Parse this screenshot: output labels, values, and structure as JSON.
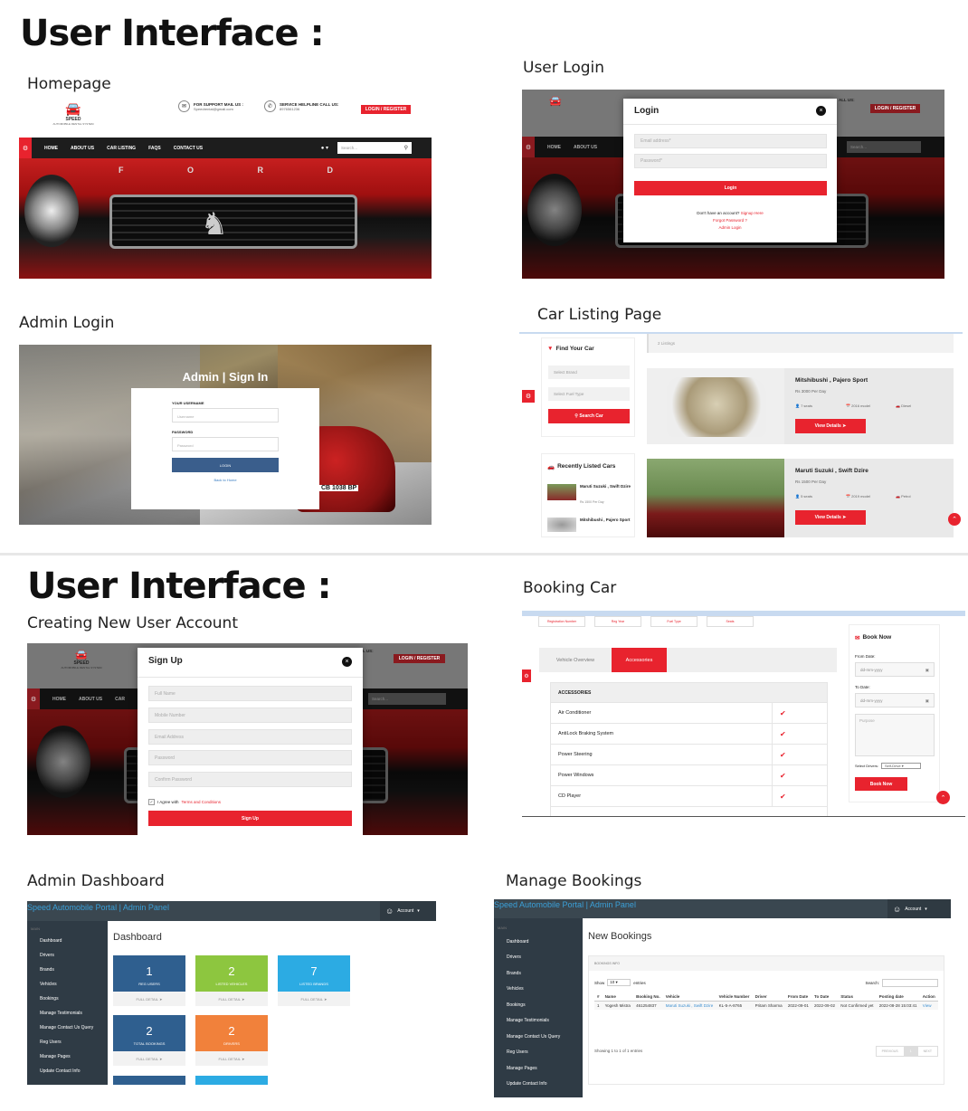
{
  "sections": {
    "top_heading": "User Interface :",
    "bottom_heading": "User Interface :"
  },
  "captions": {
    "homepage": "Homepage",
    "user_login": "User Login",
    "admin_login": "Admin Login",
    "car_listing": "Car Listing Page",
    "creating_account": "Creating New User Account",
    "booking_car": "Booking Car",
    "admin_dashboard": "Admin Dashboard",
    "manage_bookings": "Manage Bookings"
  },
  "homepage": {
    "brand": "SPEED",
    "brand_sub": "AUTOMOBILE RENTAL SYSTEM",
    "support_label": "FOR SUPPORT MAIL US :",
    "support_value": "Speedrental@gmail.com",
    "helpline_label": "SERVICE HELPLINE CALL US:",
    "helpline_value": "8976561236",
    "login_button": "LOGIN / REGISTER",
    "nav": [
      "HOME",
      "ABOUT US",
      "CAR LISTING",
      "FAQS",
      "CONTACT US"
    ],
    "search_placeholder": "Search...",
    "car_letters": "F O R D"
  },
  "user_login": {
    "title": "Login",
    "email_placeholder": "Email address*",
    "password_placeholder": "Password*",
    "login_button": "Login",
    "signup_prompt": "Don't have an account?",
    "signup_link": "Signup Here",
    "forgot_link": "Forgot Password ?",
    "admin_link": "Admin Login",
    "call_us_fragment": "ALL US:",
    "login_register": "LOGIN / REGISTER",
    "nav": [
      "HOME",
      "ABOUT US"
    ],
    "search_placeholder": "Search..."
  },
  "admin_login": {
    "title": "Admin | Sign In",
    "username_label": "YOUR USERNAME",
    "username_placeholder": "Username",
    "password_label": "PASSWORD",
    "password_placeholder": "Password",
    "login_button": "LOGIN",
    "back_link": "Back to Home",
    "plate": "CB 1038 BP"
  },
  "car_listing": {
    "find_title": "Find Your Car",
    "brand_select": "Select Brand",
    "fuel_select": "Select Fuel Type",
    "search_button": "Search Car",
    "listings_count": "2 Listings",
    "recent_title": "Recently Listed Cars",
    "recent": [
      {
        "name": "Maruti Suzuki , Swift Dzire",
        "price": "Rs 1500 Per Day"
      },
      {
        "name": "Mitshibushi , Pajero Sport",
        "price": ""
      }
    ],
    "cars": [
      {
        "name": "Mitshibushi , Pajero Sport",
        "price": "Rs 3000 Per Day",
        "seats": "7 seats",
        "model": "2016 model",
        "fuel": "Diesel",
        "button": "View Details"
      },
      {
        "name": "Maruti Suzuki , Swift Dzire",
        "price": "Rs 1500 Per Day",
        "seats": "5 seats",
        "model": "2019 model",
        "fuel": "Petrol",
        "button": "View Details"
      }
    ]
  },
  "signup": {
    "title": "Sign Up",
    "fields": [
      "Full Name",
      "Mobile Number",
      "Email Address",
      "Password",
      "Confirm Password"
    ],
    "agree_text": "I Agree with",
    "terms_link": "Terms and Conditions",
    "signup_button": "Sign Up",
    "brand": "SPEED",
    "brand_sub": "AUTOMOBILE RENTAL SYSTEM",
    "login_register": "LOGIN / REGISTER",
    "call_us_fragment": "L US:",
    "nav": [
      "HOME",
      "ABOUT US",
      "CAR"
    ],
    "search_placeholder": "Search..."
  },
  "booking": {
    "spec_tabs": [
      "Registration Number",
      "Reg Year",
      "Fuel Type",
      "Seats"
    ],
    "tab_overview": "Vehicle Overview",
    "tab_accessories": "Accessories",
    "accessories_title": "ACCESSORIES",
    "accessories": [
      "Air Conditioner",
      "AntiLock Braking System",
      "Power Steering",
      "Power Windows",
      "CD Player"
    ],
    "book_title": "Book Now",
    "from_label": "From Date:",
    "to_label": "To Date:",
    "date_placeholder": "dd-mm-yyyy",
    "purpose_placeholder": "Purpose",
    "driver_label": "Select Drivers:",
    "driver_value": "Self-Drive",
    "book_button": "Book Now"
  },
  "admin_dashboard": {
    "portal_title": "Speed Automobile Portal | Admin Panel",
    "account": "Account",
    "main_label": "MAIN",
    "menu": [
      "Dashboard",
      "Drivers",
      "Brands",
      "Vehicles",
      "Bookings",
      "Manage Testimonials",
      "Manage Contact Us Query",
      "Reg Users",
      "Manage Pages",
      "Update Contact Info"
    ],
    "page_title": "Dashboard",
    "full_detail": "FULL DETAIL",
    "tiles": [
      {
        "value": "1",
        "label": "REG USERS",
        "color": "#2f5f8f"
      },
      {
        "value": "2",
        "label": "LISTED VEHICLES",
        "color": "#8dc63f"
      },
      {
        "value": "7",
        "label": "LISTED BRANDS",
        "color": "#2cabe3"
      },
      {
        "value": "2",
        "label": "TOTAL BOOKINGS",
        "color": "#2f5f8f"
      },
      {
        "value": "2",
        "label": "DRIVERS",
        "color": "#f1813b"
      }
    ]
  },
  "manage_bookings": {
    "portal_title": "Speed Automobile Portal | Admin Panel",
    "account": "Account",
    "main_label": "MAIN",
    "menu": [
      "Dashboard",
      "Drivers",
      "Brands",
      "Vehicles",
      "Bookings",
      "Manage Testimonials",
      "Manage Contact Us Query",
      "Reg Users",
      "Manage Pages",
      "Update Contact Info"
    ],
    "page_title": "New Bookings",
    "bookings_info": "BOOKINGS INFO",
    "show_label": "Show",
    "show_value": "10",
    "entries_label": "entries",
    "search_label": "Search:",
    "columns": [
      "#",
      "Name",
      "Booking No.",
      "Vehicle",
      "Vehicle Number",
      "Driver",
      "From Date",
      "To Date",
      "Status",
      "Posting date",
      "Action"
    ],
    "rows": [
      [
        "1",
        "Yogesh Mistra",
        "461254837",
        "Maruti Suzuki , Swift Dzire",
        "KL-5-A-8765",
        "Pritam Sharma",
        "2022-09-01",
        "2022-09-02",
        "Not Confirmed yet",
        "2022-08-28 15:03:41",
        "View"
      ]
    ],
    "showing": "Showing 1 to 1 of 1 entries",
    "previous": "PREVIOUS",
    "page": "1",
    "next": "NEXT"
  },
  "colors": {
    "accent_red": "#e8232e",
    "admin_blue": "#3a5e8c",
    "sidebar": "#2f3b45",
    "topbar": "#3a4750"
  }
}
